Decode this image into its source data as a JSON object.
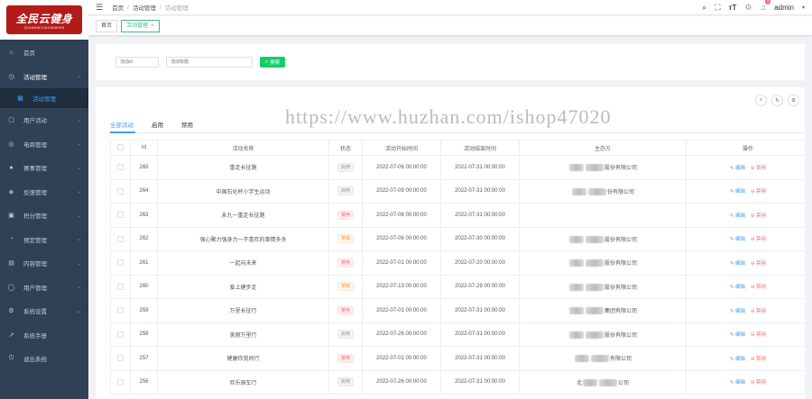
{
  "logo": {
    "main": "全民云健身",
    "sub": "QUANMINYUNJIANSHEN"
  },
  "sidebar": {
    "items": [
      {
        "icon": "⌂",
        "label": "首页",
        "arrow": false
      },
      {
        "icon": "◷",
        "label": "活动管理",
        "arrow": true
      },
      {
        "icon": "▦",
        "label": "活动管理",
        "sub": true
      },
      {
        "icon": "▢",
        "label": "用户活动",
        "arrow": true
      },
      {
        "icon": "◎",
        "label": "电商管理",
        "arrow": true
      },
      {
        "icon": "●",
        "label": "赛事管理",
        "arrow": true
      },
      {
        "icon": "◈",
        "label": "反馈管理",
        "arrow": true
      },
      {
        "icon": "▣",
        "label": "积分管理",
        "arrow": true
      },
      {
        "icon": "◔",
        "label": "预定管理",
        "arrow": true
      },
      {
        "icon": "▤",
        "label": "内容管理",
        "arrow": true
      },
      {
        "icon": "◯",
        "label": "用户管理",
        "arrow": true
      },
      {
        "icon": "⚙",
        "label": "系统设置",
        "arrow": true
      },
      {
        "icon": "↗",
        "label": "系统手册",
        "arrow": false
      },
      {
        "icon": "⏻",
        "label": "退出系统",
        "arrow": false
      }
    ]
  },
  "header": {
    "breadcrumb": [
      "首页",
      "活动管理",
      "活动管理"
    ],
    "user": "admin",
    "badge": "3"
  },
  "tags": [
    {
      "label": "首页",
      "active": false
    },
    {
      "label": "活动管理",
      "active": true,
      "close": "×"
    }
  ],
  "search": {
    "placeholder1": "活动id",
    "placeholder2": "活动标题",
    "button": "搜索"
  },
  "watermark": "https://www.huzhan.com/ishop47020",
  "toolbar": {
    "search_icon": "⌕",
    "refresh_icon": "↻",
    "settings_icon": "⚙"
  },
  "tabs": [
    {
      "label": "全部活动",
      "active": true
    },
    {
      "label": "启用",
      "active": false
    },
    {
      "label": "禁用",
      "active": false
    }
  ],
  "table": {
    "headers": [
      "",
      "Id",
      "活动名称",
      "状态",
      "活动开始时间",
      "活动结束时间",
      "主办方",
      "操作"
    ],
    "edit_label": "编辑",
    "disable_label": "禁用",
    "rows": [
      {
        "id": "265",
        "name": "重走长征路",
        "status": "启用",
        "status_type": "gray",
        "start": "2022-07-06 00:00:00",
        "end": "2022-07-31 00:00:00",
        "org_a": "",
        "org_b": "股份有限公司"
      },
      {
        "id": "264",
        "name": "中国石化杯小学生运动",
        "status": "启用",
        "status_type": "gray",
        "start": "2022-07-09 00:00:00",
        "end": "2022-07-31 00:00:00",
        "org_a": "",
        "org_b": "份有限公司"
      },
      {
        "id": "263",
        "name": "永九一重走长征路",
        "status": "禁用",
        "status_type": "red",
        "start": "2022-07-06 00:00:00",
        "end": "2022-07-31 00:00:00",
        "org_a": "",
        "org_b": ""
      },
      {
        "id": "262",
        "name": "强心聚力强身力一不喜欢的事情多多",
        "status": "草稿",
        "status_type": "orange",
        "start": "2022-07-06 00:00:00",
        "end": "2022-07-30 00:00:00",
        "org_a": "",
        "org_b": "股份有限公司"
      },
      {
        "id": "261",
        "name": "一起向未来",
        "status": "禁用",
        "status_type": "red",
        "start": "2022-07-01 00:00:00",
        "end": "2022-07-20 00:00:00",
        "org_a": "",
        "org_b": "股份有限公司"
      },
      {
        "id": "260",
        "name": "爱上健步走",
        "status": "草稿",
        "status_type": "orange",
        "start": "2022-07-13 00:00:00",
        "end": "2022-07-29 00:00:00",
        "org_a": "",
        "org_b": "股份有限公司"
      },
      {
        "id": "259",
        "name": "万里长征行",
        "status": "禁用",
        "status_type": "red",
        "start": "2022-07-01 00:00:00",
        "end": "2022-07-31 00:00:00",
        "org_a": "",
        "org_b": "集团有限公司"
      },
      {
        "id": "258",
        "name": "美丽万里行",
        "status": "启用",
        "status_type": "gray",
        "start": "2022-07-26 00:00:00",
        "end": "2022-07-31 00:00:00",
        "org_a": "",
        "org_b": "股份有限公司"
      },
      {
        "id": "257",
        "name": "健康你我同行",
        "status": "禁用",
        "status_type": "red",
        "start": "2022-07-01 00:00:00",
        "end": "2022-07-31 00:00:00",
        "org_a": "",
        "org_b": "有限公司"
      },
      {
        "id": "256",
        "name": "欢乐骑车行",
        "status": "启用",
        "status_type": "gray",
        "start": "2022-07-26 00:00:00",
        "end": "2022-07-31 00:00:00",
        "org_a": "北",
        "org_b": "公司"
      }
    ]
  }
}
